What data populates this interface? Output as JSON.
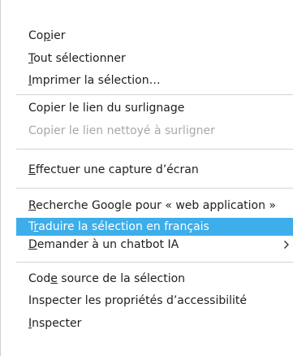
{
  "context_menu": {
    "items": [
      {
        "pre": "Co",
        "key": "p",
        "post": "ier",
        "disabled": false
      },
      {
        "pre": "",
        "key": "T",
        "post": "out sélectionner",
        "disabled": false
      },
      {
        "pre": "",
        "key": "I",
        "post": "mprimer la sélection…",
        "disabled": false
      },
      {
        "pre": "Copier le lien du surlignage",
        "key": "",
        "post": "",
        "disabled": false
      },
      {
        "pre": "Copier le lien nettoyé à surligner",
        "key": "",
        "post": "",
        "disabled": true
      },
      {
        "pre": "",
        "key": "E",
        "post": "ffectuer une capture d’écran",
        "disabled": false
      },
      {
        "pre": "",
        "key": "R",
        "post": "echerche Google pour « web application »",
        "disabled": false
      },
      {
        "pre": "T",
        "key": "r",
        "post": "aduire la sélection en français",
        "disabled": false,
        "highlighted": true
      },
      {
        "pre": "",
        "key": "D",
        "post": "emander à un chatbot IA",
        "disabled": false,
        "has_submenu": true
      },
      {
        "pre": "Cod",
        "key": "e",
        "post": " source de la sélection",
        "disabled": false
      },
      {
        "pre": "Inspecter les propriétés d’accessibilité",
        "key": "",
        "post": "",
        "disabled": false
      },
      {
        "pre": "",
        "key": "I",
        "post": "nspecter",
        "disabled": false
      }
    ],
    "highlight_color": "#3daee9",
    "disabled_text_color": "#a8a8a8"
  }
}
